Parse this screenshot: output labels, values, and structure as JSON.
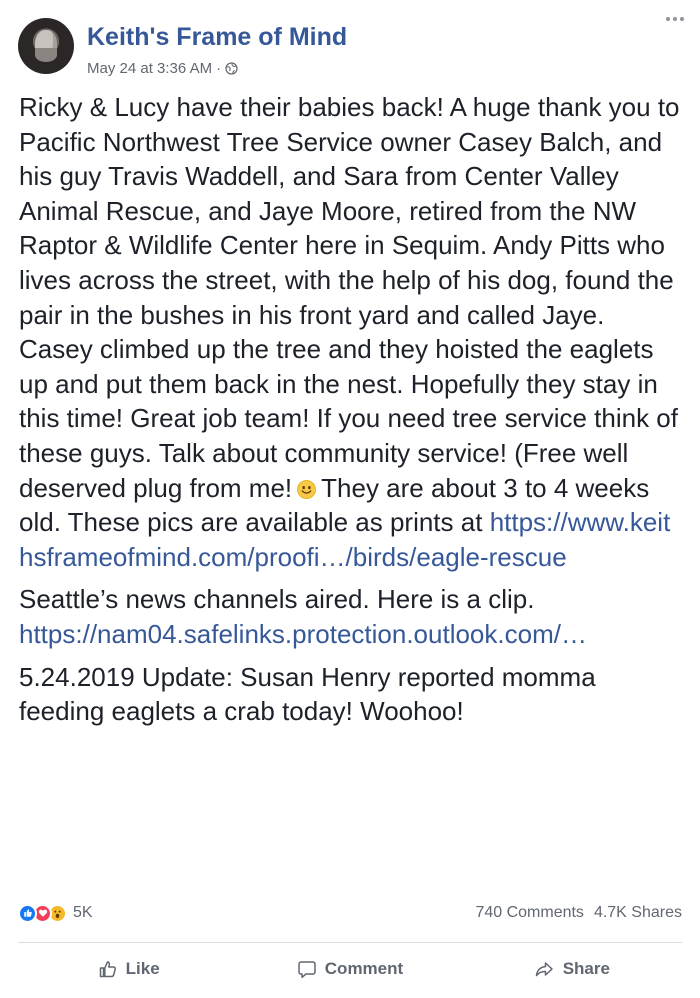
{
  "post": {
    "page_name": "Keith's Frame of Mind",
    "date": "May 24 at 3:36 AM",
    "separator": "·",
    "privacy_icon": "globe-icon",
    "more_icon": "more-options-icon",
    "paragraph_1_before_emoji": "Ricky & Lucy have their babies back! A huge thank you to Pacific Northwest Tree Service owner Casey Balch, and his guy Travis Waddell, and Sara from Center Valley Animal Rescue, and Jaye Moore, retired from the NW Raptor & Wildlife Center here in Sequim. Andy Pitts who lives across the street, with the help of his dog, found the pair in the bushes in his front yard and called Jaye. Casey climbed up the tree and they hoisted the eaglets up and put them back in the nest. Hopefully they stay in this time! Great job team! If you need tree service think of these guys. Talk about community service! (Free well deserved plug from me!",
    "emoji": "smiley-emoji-icon",
    "paragraph_1_after_emoji": "They are about 3 to 4 weeks old. These pics are available as prints at",
    "link_1": "https://www.keithsframeofmind.com/proofi…/birds/eagle-rescue",
    "paragraph_2_text": "Seattle’s news channels aired. Here is a clip.",
    "link_2": "https://nam04.safelinks.protection.outlook.com/…",
    "paragraph_3": "5.24.2019 Update: Susan Henry reported momma feeding eaglets a crab today! Woohoo!"
  },
  "stats": {
    "reaction_icons": [
      "like-reaction-icon",
      "love-reaction-icon",
      "wow-reaction-icon"
    ],
    "reaction_count": "5K",
    "comments": "740 Comments",
    "shares": "4.7K Shares"
  },
  "actions": {
    "like": "Like",
    "comment": "Comment",
    "share": "Share"
  },
  "colors": {
    "link": "#365899",
    "text": "#1d2129",
    "meta": "#616770",
    "like_blue": "#1877f2",
    "love_red": "#f33e58",
    "wow_yellow": "#f7b928"
  }
}
